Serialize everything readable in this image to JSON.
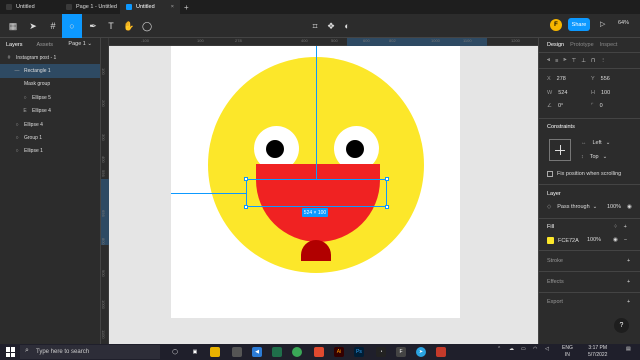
{
  "tabs": [
    {
      "label": "Untitled",
      "active": false
    },
    {
      "label": "Page 1 - Untitled",
      "active": false
    },
    {
      "label": "Untitled",
      "active": true
    }
  ],
  "toolbar": {
    "tools": [
      "menu-icon",
      "move-icon",
      "frame-icon",
      "ellipse-icon",
      "pen-icon",
      "text-icon",
      "hand-icon",
      "comment-icon"
    ],
    "center_tools": [
      "component-icon",
      "mask-icon",
      "contrast-icon"
    ],
    "avatar_initial": "F",
    "share_label": "Share",
    "zoom": "64%"
  },
  "left_panel": {
    "tab_layers": "Layers",
    "tab_assets": "Assets",
    "page": "Page 1",
    "layers": [
      {
        "label": "Instagram post - 1",
        "icon": "#",
        "indent": 0,
        "selected": false
      },
      {
        "label": "Rectangle 1",
        "icon": "—",
        "indent": 1,
        "selected": true
      },
      {
        "label": "Mask group",
        "icon": "",
        "indent": 1,
        "selected": false
      },
      {
        "label": "Ellipse 5",
        "icon": "○",
        "indent": 2,
        "selected": false
      },
      {
        "label": "Ellipse 4",
        "icon": "E",
        "indent": 2,
        "selected": false
      },
      {
        "label": "Ellipse 4",
        "icon": "○",
        "indent": 1,
        "selected": false
      },
      {
        "label": "Group 1",
        "icon": "○",
        "indent": 1,
        "selected": false
      },
      {
        "label": "Ellipse 1",
        "icon": "○",
        "indent": 1,
        "selected": false
      }
    ]
  },
  "rulers": {
    "top": [
      "-100",
      "100",
      "278",
      "400",
      "500",
      "600",
      "802",
      "1000",
      "1100",
      "1200"
    ],
    "left": [
      "100",
      "200",
      "300",
      "400",
      "556",
      "656",
      "800",
      "900",
      "1000",
      "1100"
    ]
  },
  "canvas": {
    "selection_size": "524 × 100"
  },
  "right_panel": {
    "tab_design": "Design",
    "tab_prototype": "Prototype",
    "tab_inspect": "Inspect",
    "x_label": "X",
    "x_value": "278",
    "y_label": "Y",
    "y_value": "556",
    "w_label": "W",
    "w_value": "524",
    "h_label": "H",
    "h_value": "100",
    "rotation": "0°",
    "radius": "0",
    "constraints_title": "Constraints",
    "constraint_h": "Left",
    "constraint_v": "Top",
    "fix_position": "Fix position when scrolling",
    "layer_title": "Layer",
    "blend_mode": "Pass through",
    "layer_opacity": "100%",
    "fill_title": "Fill",
    "fill_hex": "FCE72A",
    "fill_opacity": "100%",
    "stroke_title": "Stroke",
    "effects_title": "Effects",
    "export_title": "Export",
    "fill_color": "#fce72a"
  },
  "taskbar": {
    "search_placeholder": "Type here to search",
    "lang_top": "ENG",
    "lang_bottom": "IN",
    "time": "3:17 PM",
    "date": "5/7/2022"
  }
}
